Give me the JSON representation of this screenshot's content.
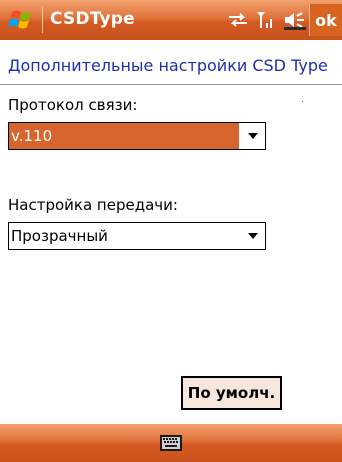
{
  "titlebar": {
    "title": "CSDType",
    "ok_label": "ok"
  },
  "icons": {
    "start": "windows-flag-icon",
    "connectivity": "connectivity-arrows-icon",
    "signal": "signal-strength-icon",
    "volume": "speaker-muted-icon",
    "keyboard": "keyboard-icon"
  },
  "header": {
    "title": "Дополнительные настройки CSD Type"
  },
  "protocol": {
    "label": "Протокол связи:",
    "value": "v.110"
  },
  "transfer": {
    "label": "Настройка передачи:",
    "value": "Прозрачный"
  },
  "buttons": {
    "default_label": "По умолч."
  },
  "colors": {
    "bar_orange": "#d45a22",
    "header_blue": "#1f2fa8",
    "selection": "#d9652e"
  }
}
